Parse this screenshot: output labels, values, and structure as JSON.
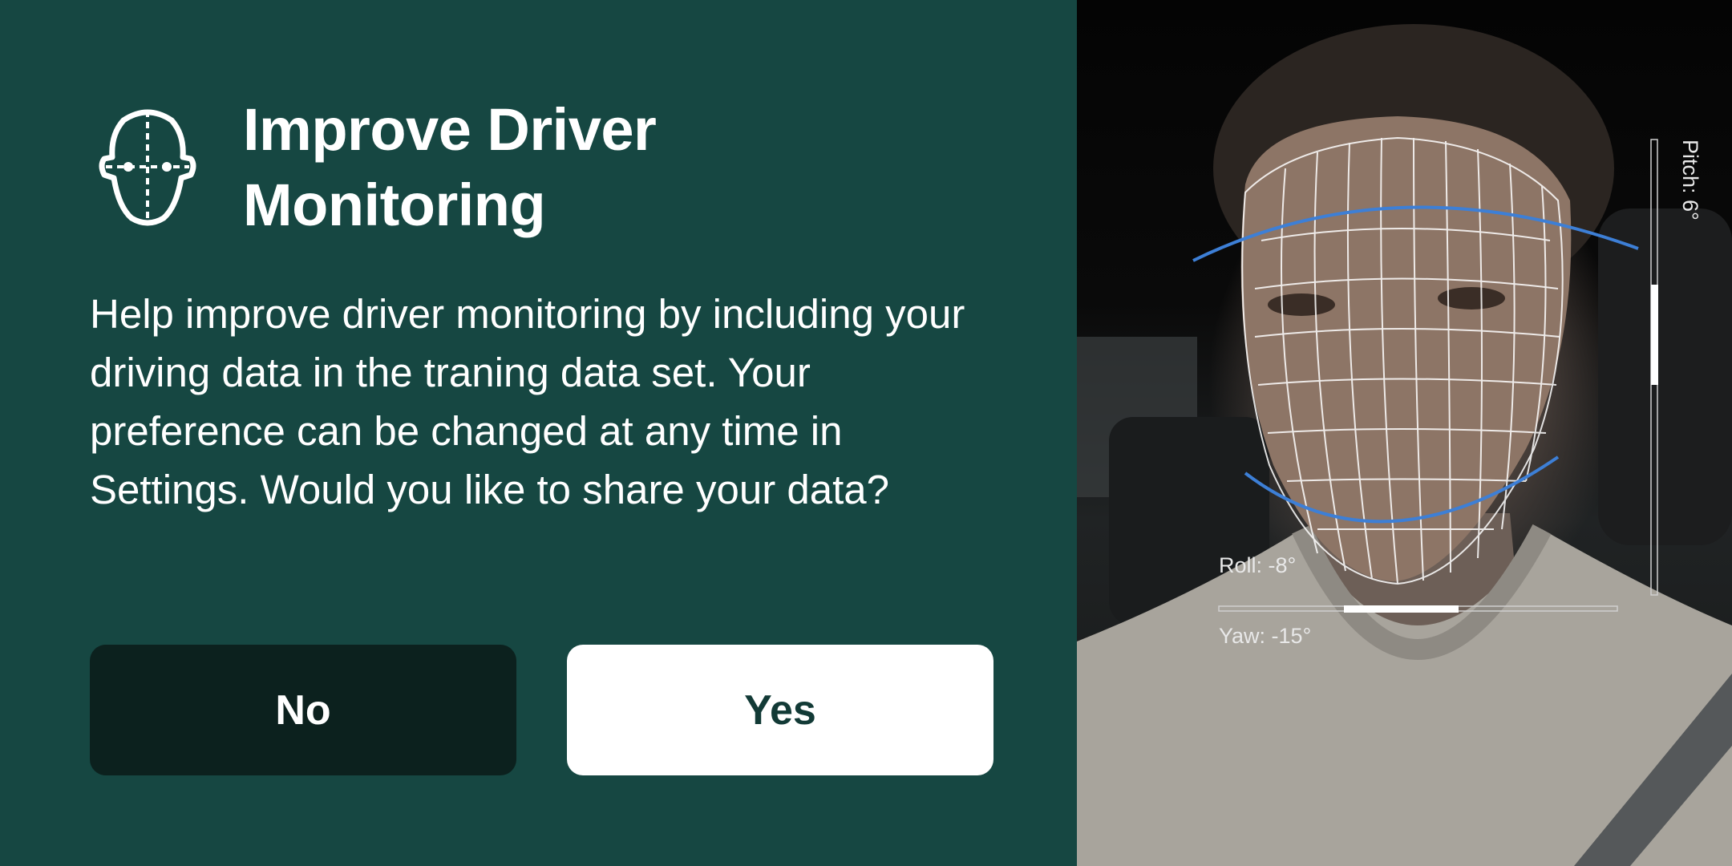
{
  "dialog": {
    "icon": "driver-head-icon",
    "title": "Improve Driver\nMonitoring",
    "body": "Help improve driver monitoring by including your driving data in the traning data set. Your preference can be changed at any time in Settings. Would you like to share your data?",
    "buttons": {
      "no_label": "No",
      "yes_label": "Yes"
    }
  },
  "camera_preview": {
    "roll_label": "Roll: -8°",
    "yaw_label": "Yaw: -15°",
    "pitch_label": "Pitch: 6°"
  },
  "colors": {
    "panel_bg": "#164742",
    "no_button_bg": "#0c211e",
    "yes_button_bg": "#ffffff",
    "face_mesh": "#ffffff",
    "face_contour": "#3d7fd6"
  }
}
